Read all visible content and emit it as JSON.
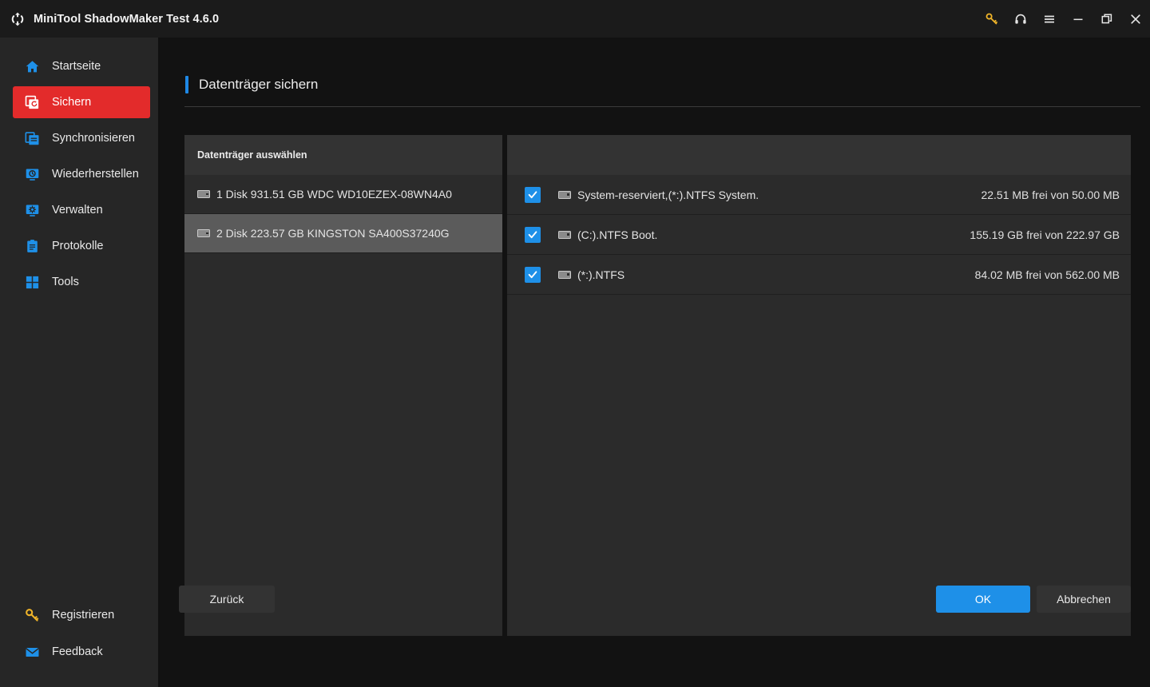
{
  "window": {
    "title": "MiniTool ShadowMaker Test 4.6.0",
    "logo_icon": "sync-arrows-icon",
    "controls": [
      {
        "name": "register-key-icon",
        "label": "Registrieren",
        "icon": "key-icon"
      },
      {
        "name": "support-icon",
        "label": "Support",
        "icon": "headset-icon"
      },
      {
        "name": "menu-icon",
        "label": "Menü",
        "icon": "hamburger-icon"
      },
      {
        "name": "minimize-button",
        "label": "Minimieren",
        "icon": "minimize-icon"
      },
      {
        "name": "maximize-button",
        "label": "Maximieren",
        "icon": "restore-icon"
      },
      {
        "name": "close-button",
        "label": "Schließen",
        "icon": "close-icon"
      }
    ]
  },
  "sidebar": {
    "items": [
      {
        "label": "Startseite",
        "icon": "home-icon",
        "active": false
      },
      {
        "label": "Sichern",
        "icon": "backup-icon",
        "active": true
      },
      {
        "label": "Synchronisieren",
        "icon": "sync-icon",
        "active": false
      },
      {
        "label": "Wiederherstellen",
        "icon": "restore-monitor-icon",
        "active": false
      },
      {
        "label": "Verwalten",
        "icon": "manage-gear-icon",
        "active": false
      },
      {
        "label": "Protokolle",
        "icon": "log-icon",
        "active": false
      },
      {
        "label": "Tools",
        "icon": "tools-grid-icon",
        "active": false
      }
    ],
    "bottom_items": [
      {
        "label": "Registrieren",
        "icon": "key-icon"
      },
      {
        "label": "Feedback",
        "icon": "mail-icon"
      }
    ]
  },
  "page": {
    "title": "Datenträger sichern",
    "accent_color": "#1e88e5"
  },
  "disk_panel": {
    "header": "Datenträger auswählen",
    "disks": [
      {
        "label": "1 Disk 931.51 GB WDC WD10EZEX-08WN4A0",
        "selected": false
      },
      {
        "label": "2 Disk 223.57 GB KINGSTON SA400S37240G",
        "selected": true
      }
    ]
  },
  "partition_panel": {
    "header": "",
    "partitions": [
      {
        "name": "System-reserviert,(*:).NTFS System.",
        "size": "22.51 MB frei von 50.00 MB",
        "checked": true
      },
      {
        "name": "(C:).NTFS Boot.",
        "size": "155.19 GB frei von 222.97 GB",
        "checked": true
      },
      {
        "name": "(*:).NTFS",
        "size": "84.02 MB frei von 562.00 MB",
        "checked": true
      }
    ]
  },
  "footer": {
    "back_label": "Zurück",
    "ok_label": "OK",
    "cancel_label": "Abbrechen"
  },
  "colors": {
    "accent_blue": "#1e90e8",
    "active_red": "#e32b2b",
    "key_gold": "#f0b429",
    "panel_bg": "#2b2b2b",
    "window_bg": "#121212"
  }
}
